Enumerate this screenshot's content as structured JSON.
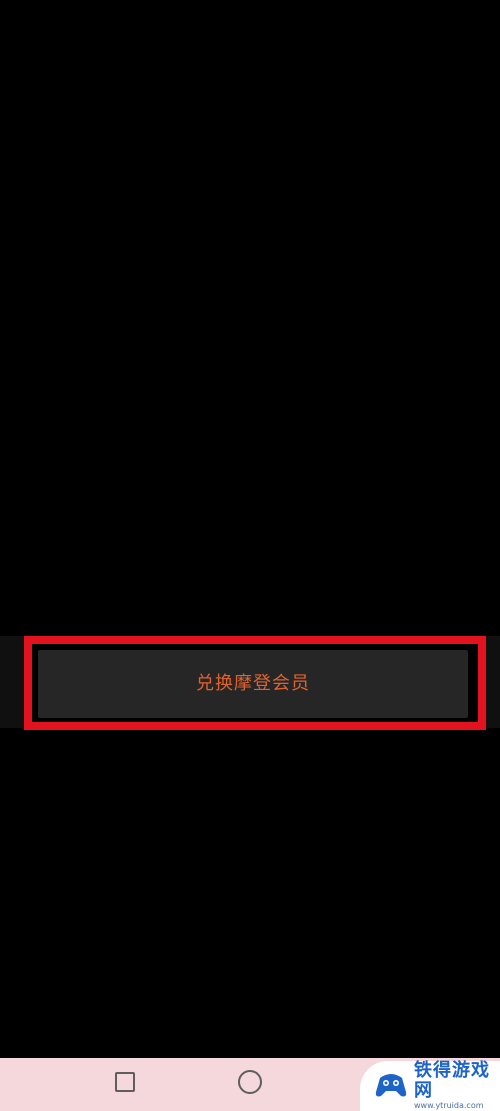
{
  "button": {
    "label": "兑换摩登会员"
  },
  "watermark": {
    "title": "铁得游戏网",
    "url": "www.ytruida.com"
  },
  "colors": {
    "highlight": "#e2121f",
    "button_text": "#e0632e",
    "button_bg": "#262626",
    "navbar_bg": "#f4d8dc"
  },
  "icons": {
    "recent": "square-icon",
    "home": "circle-icon",
    "logo": "gamepad-icon"
  }
}
